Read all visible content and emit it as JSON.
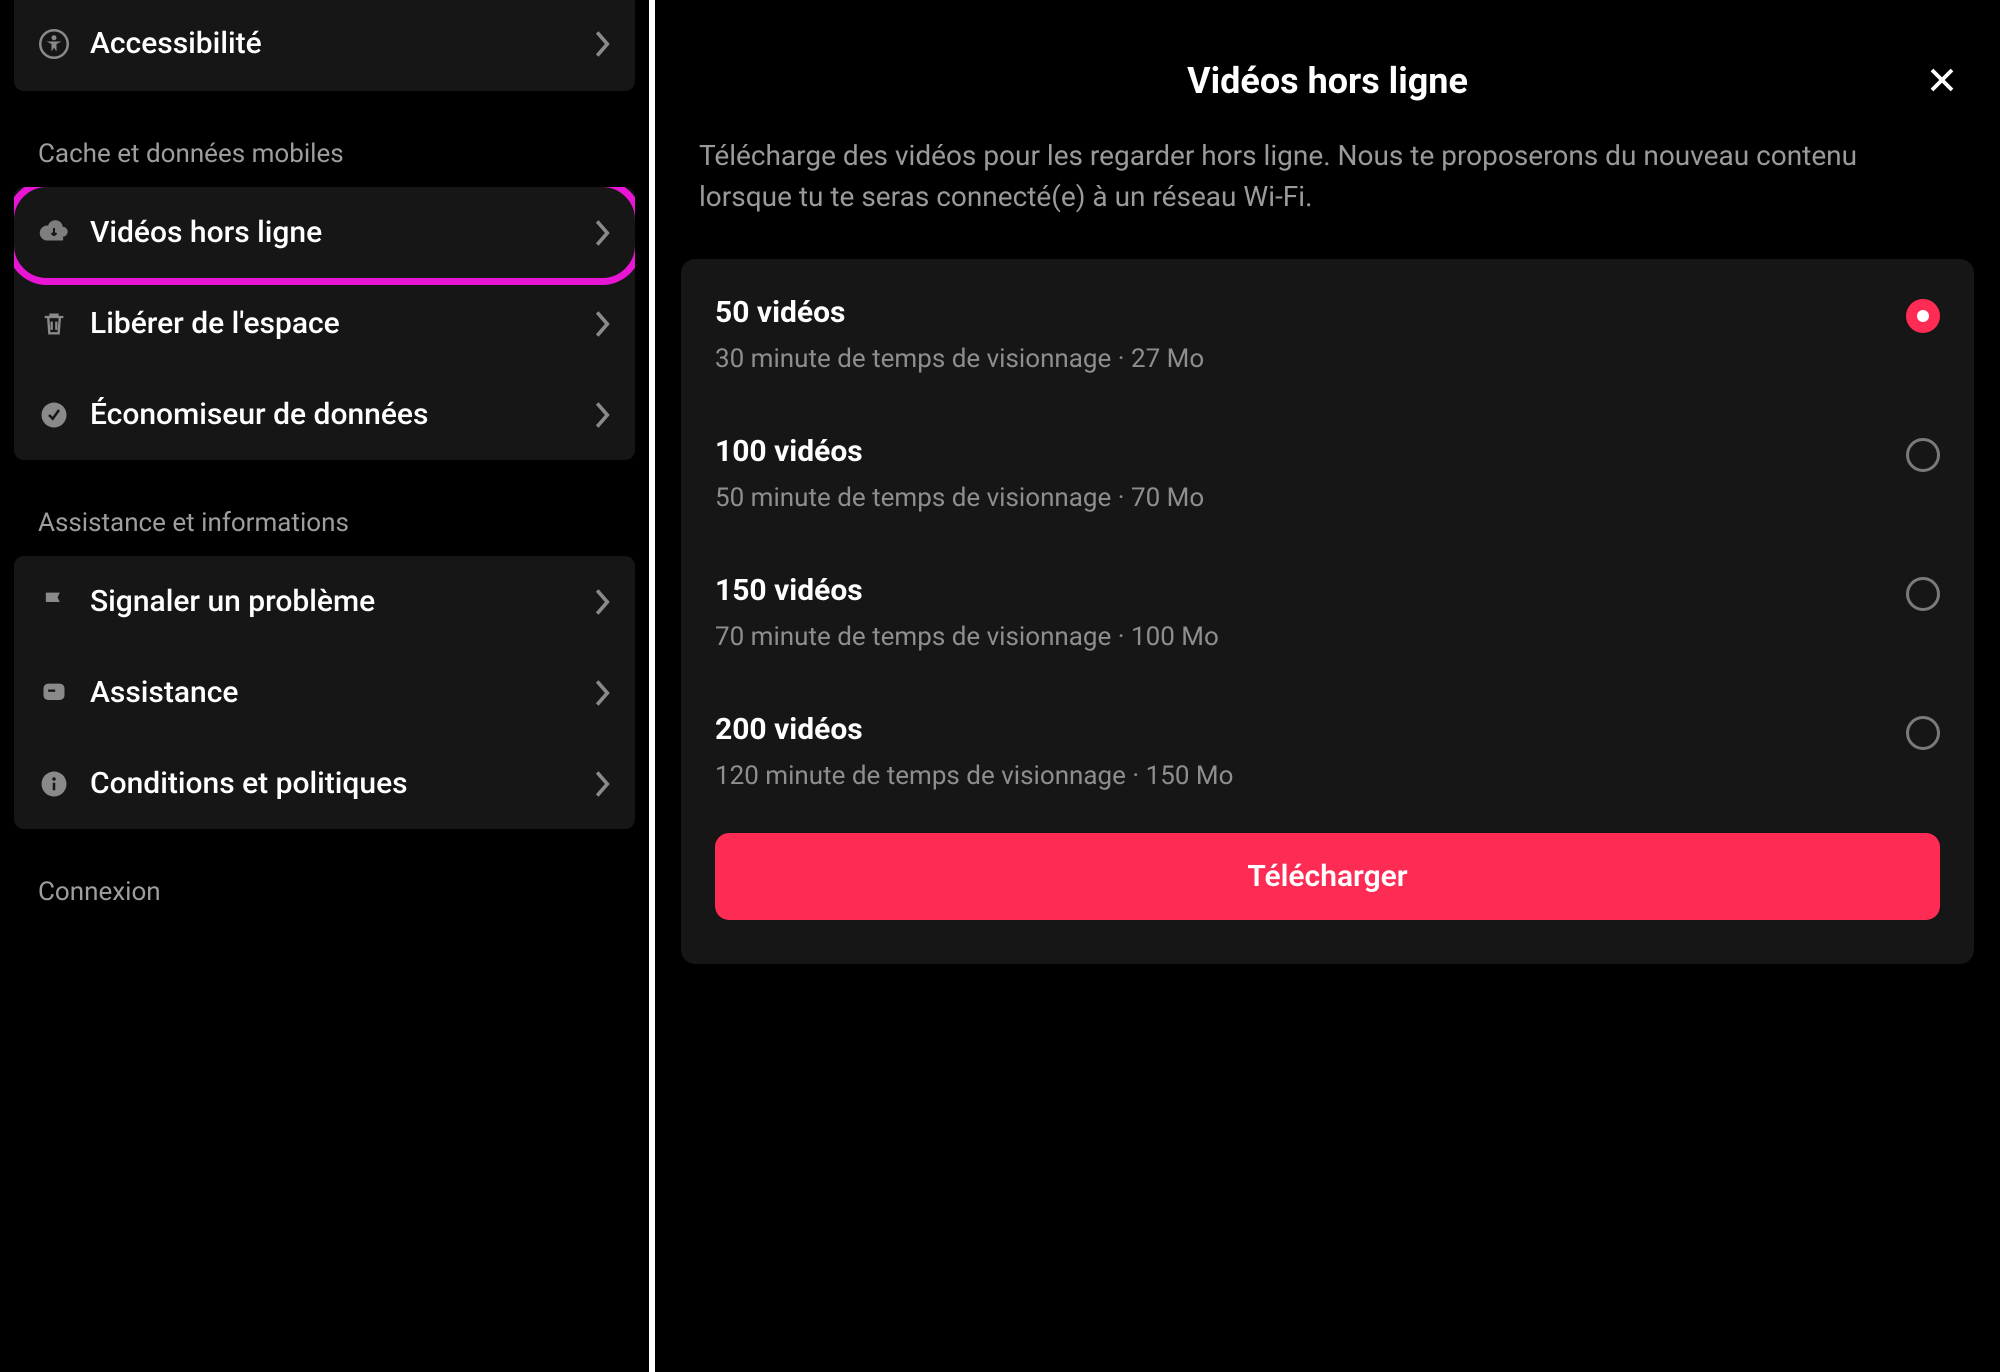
{
  "left": {
    "group0": {
      "accessibility": "Accessibilité"
    },
    "section_cache": "Cache et données mobiles",
    "group1": {
      "offline_videos": "Vidéos hors ligne",
      "free_space": "Libérer de l'espace",
      "data_saver": "Économiseur de données"
    },
    "section_support": "Assistance et informations",
    "group2": {
      "report_problem": "Signaler un problème",
      "assistance": "Assistance",
      "terms": "Conditions et politiques"
    },
    "section_login": "Connexion"
  },
  "right": {
    "title": "Vidéos hors ligne",
    "description": "Télécharge des vidéos pour les regarder hors ligne. Nous te proposerons du nouveau contenu lorsque tu te seras connecté(e) à un réseau Wi-Fi.",
    "options": [
      {
        "title": "50 vidéos",
        "sub": "30 minute de temps de visionnage · 27 Mo",
        "selected": true
      },
      {
        "title": "100 vidéos",
        "sub": "50 minute de temps de visionnage · 70 Mo",
        "selected": false
      },
      {
        "title": "150 vidéos",
        "sub": "70 minute de temps de visionnage · 100 Mo",
        "selected": false
      },
      {
        "title": "200 vidéos",
        "sub": "120 minute de temps de visionnage · 150 Mo",
        "selected": false
      }
    ],
    "download_label": "Télécharger"
  }
}
